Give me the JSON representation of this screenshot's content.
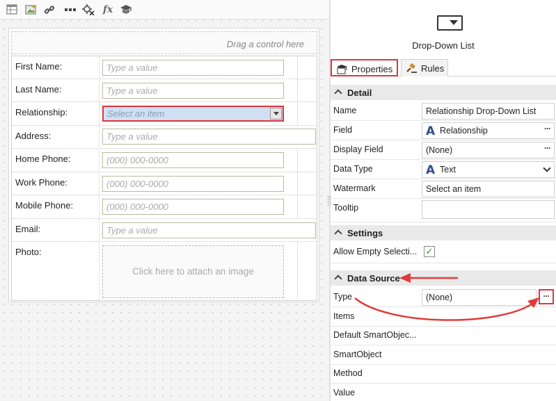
{
  "toolbar": {
    "icons": [
      "table-icon",
      "image-edit-icon",
      "link-icon",
      "ellipsis-icon",
      "settings-cross-icon",
      "fx-icon",
      "graduation-cap-icon"
    ],
    "fx_label": "fx"
  },
  "form": {
    "drop_zone": "Drag a control here",
    "rows": [
      {
        "label": "First Name:",
        "placeholder": "Type a value"
      },
      {
        "label": "Last Name:",
        "placeholder": "Type a value"
      },
      {
        "label": "Relationship:",
        "placeholder": "Select an item"
      },
      {
        "label": "Address:",
        "placeholder": "Type a value"
      },
      {
        "label": "Home Phone:",
        "placeholder": "(000) 000-0000"
      },
      {
        "label": "Work Phone:",
        "placeholder": "(000) 000-0000"
      },
      {
        "label": "Mobile Phone:",
        "placeholder": "(000) 000-0000"
      },
      {
        "label": "Email:",
        "placeholder": "Type a value"
      },
      {
        "label": "Photo:",
        "placeholder": "Click here to attach an image"
      }
    ]
  },
  "panel": {
    "control_title": "Drop-Down List",
    "tabs": {
      "properties": "Properties",
      "rules": "Rules"
    },
    "detail": {
      "header": "Detail",
      "rows": [
        {
          "label": "Name",
          "value": "Relationship Drop-Down List"
        },
        {
          "label": "Field",
          "value": "Relationship"
        },
        {
          "label": "Display Field",
          "value": "(None)"
        },
        {
          "label": "Data Type",
          "value": "Text"
        },
        {
          "label": "Watermark",
          "value": "Select an item"
        },
        {
          "label": "Tooltip",
          "value": ""
        }
      ]
    },
    "settings": {
      "header": "Settings",
      "rows": [
        {
          "label": "Allow Empty Selecti...",
          "checked": true,
          "check_glyph": "✓"
        }
      ]
    },
    "data_source": {
      "header": "Data Source",
      "rows": [
        {
          "label": "Type",
          "value": "(None)"
        },
        {
          "label": "Items"
        },
        {
          "label": "Default SmartObjec..."
        },
        {
          "label": "SmartObject"
        },
        {
          "label": "Method"
        },
        {
          "label": "Value"
        }
      ]
    },
    "ellipsis": "···",
    "field_type_glyph": "A"
  },
  "colors": {
    "highlight_red": "#d9363e",
    "dropdown_fill": "#cfe0f3",
    "section_bg": "#e9e9e9"
  }
}
